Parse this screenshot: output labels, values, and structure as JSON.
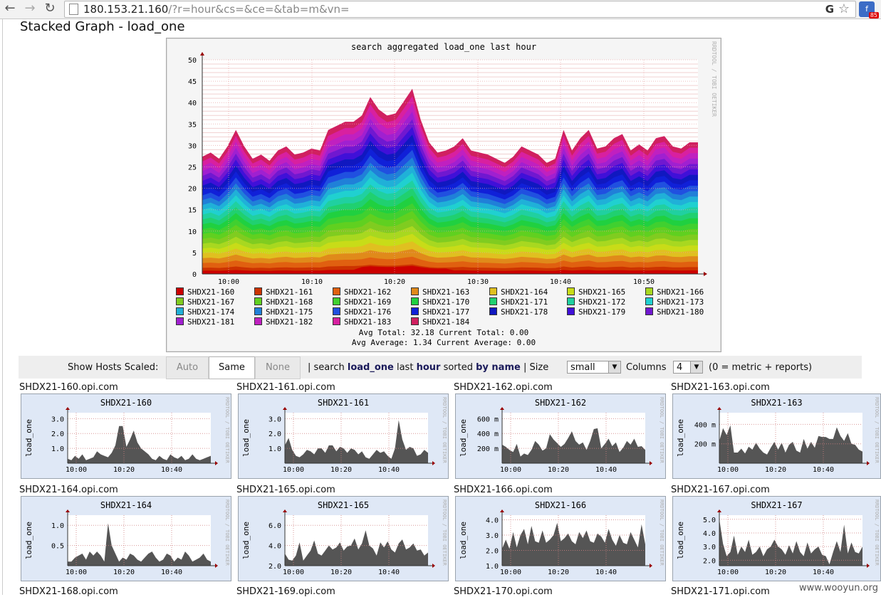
{
  "browser": {
    "url_host": "180.153.21.160",
    "url_rest": "/?r=hour&cs=&ce=&tab=m&vn=",
    "ext_badge": "85",
    "back_icon": "arrow-left-icon",
    "forward_icon": "arrow-right-icon",
    "reload_icon": "reload-icon"
  },
  "page": {
    "title": "Stacked Graph - load_one"
  },
  "main_graph": {
    "title": "search aggregated load_one last hour",
    "side_text": "RRDTOOL / TOBI OETIKER",
    "avg_total_line": "Avg Total: 32.18   Current Total:  0.00",
    "avg_avg_line": "Avg Average:  1.34   Current Average:  0.00"
  },
  "chart_data": [
    {
      "type": "area",
      "title": "search aggregated load_one last hour",
      "xlabel": "",
      "ylabel": "",
      "ylim": [
        0,
        50
      ],
      "y_ticks": [
        0,
        5,
        10,
        15,
        20,
        25,
        30,
        35,
        40,
        45,
        50
      ],
      "x_tick_labels": [
        "10:00",
        "10:10",
        "10:20",
        "10:30",
        "10:40",
        "10:50"
      ],
      "legend_placement": "bottom",
      "total_envelope": [
        28.5,
        29.5,
        28,
        31,
        35,
        31,
        28,
        29,
        27.5,
        30,
        31,
        29,
        29.5,
        30.5,
        30,
        35,
        36,
        37,
        37,
        38.5,
        43,
        40,
        38.5,
        39,
        42,
        45,
        37.5,
        32,
        29.5,
        30,
        31,
        33,
        30,
        29.5,
        29,
        28,
        27,
        28.5,
        31,
        30,
        29,
        27,
        28,
        35,
        30,
        33,
        35,
        30.5,
        31,
        33,
        34,
        30,
        31.5,
        30,
        33,
        33.5,
        31,
        30.5,
        32,
        32
      ],
      "series": [
        {
          "name": "SHDX21-160",
          "color": "#cc0000"
        },
        {
          "name": "SHDX21-161",
          "color": "#cc3300"
        },
        {
          "name": "SHDX21-162",
          "color": "#e06010"
        },
        {
          "name": "SHDX21-163",
          "color": "#e08a1a"
        },
        {
          "name": "SHDX21-164",
          "color": "#e0c020"
        },
        {
          "name": "SHDX21-165",
          "color": "#c8dc18"
        },
        {
          "name": "SHDX21-166",
          "color": "#a8d820"
        },
        {
          "name": "SHDX21-167",
          "color": "#80cc20"
        },
        {
          "name": "SHDX21-168",
          "color": "#60d020"
        },
        {
          "name": "SHDX21-169",
          "color": "#40d030"
        },
        {
          "name": "SHDX21-170",
          "color": "#20d040"
        },
        {
          "name": "SHDX21-171",
          "color": "#20d070"
        },
        {
          "name": "SHDX21-172",
          "color": "#20d0a0"
        },
        {
          "name": "SHDX21-173",
          "color": "#20d0d0"
        },
        {
          "name": "SHDX21-174",
          "color": "#20b0d8"
        },
        {
          "name": "SHDX21-175",
          "color": "#2080d8"
        },
        {
          "name": "SHDX21-176",
          "color": "#2050e0"
        },
        {
          "name": "SHDX21-177",
          "color": "#1020d8"
        },
        {
          "name": "SHDX21-178",
          "color": "#1018c0"
        },
        {
          "name": "SHDX21-179",
          "color": "#4010d8"
        },
        {
          "name": "SHDX21-180",
          "color": "#7018d0"
        },
        {
          "name": "SHDX21-181",
          "color": "#a020d0"
        },
        {
          "name": "SHDX21-182",
          "color": "#c020c0"
        },
        {
          "name": "SHDX21-183",
          "color": "#d820a0"
        },
        {
          "name": "SHDX21-184",
          "color": "#d02060"
        }
      ]
    },
    {
      "type": "area",
      "title": "SHDX21-160",
      "ylabel": "load_one",
      "y_ticks": [
        "1.0",
        "2.0",
        "3.0"
      ],
      "ylim": [
        0,
        3.4
      ],
      "x_tick_labels": [
        "10:00",
        "10:20",
        "10:40"
      ],
      "values": [
        0.3,
        0.2,
        0.5,
        0.3,
        0.6,
        0.2,
        0.3,
        0.4,
        0.8,
        0.6,
        0.5,
        0.4,
        0.7,
        1.2,
        2.5,
        2.5,
        1.1,
        1.6,
        2.2,
        1.4,
        1.0,
        0.8,
        0.6,
        0.3,
        0.2,
        0.5,
        0.3,
        0.2,
        0.6,
        0.4,
        0.3,
        0.5,
        0.2,
        0.3,
        0.6,
        0.3,
        0.2,
        0.3,
        0.4,
        0.5
      ]
    },
    {
      "type": "area",
      "title": "SHDX21-161",
      "ylabel": "load_one",
      "y_ticks": [
        "1.0",
        "2.0",
        "3.0"
      ],
      "ylim": [
        0,
        3.4
      ],
      "x_tick_labels": [
        "10:00",
        "10:20",
        "10:40"
      ],
      "values": [
        1.2,
        1.7,
        0.9,
        0.5,
        0.4,
        0.6,
        0.9,
        0.8,
        0.6,
        1.0,
        1.0,
        0.7,
        1.2,
        1.2,
        0.8,
        1.1,
        1.0,
        0.7,
        1.0,
        0.9,
        0.6,
        0.8,
        0.4,
        0.3,
        0.6,
        0.9,
        0.7,
        0.8,
        0.5,
        0.3,
        1.0,
        2.9,
        1.6,
        0.9,
        1.1,
        1.0,
        0.5,
        0.6,
        0.9,
        0.7
      ]
    },
    {
      "type": "area",
      "title": "SHDX21-162",
      "ylabel": "load_one",
      "y_ticks": [
        "200 m",
        "400 m",
        "600 m"
      ],
      "ylim": [
        0,
        680
      ],
      "x_tick_labels": [
        "10:00",
        "10:20",
        "10:40"
      ],
      "values": [
        250,
        220,
        180,
        150,
        260,
        90,
        130,
        110,
        180,
        300,
        250,
        170,
        200,
        390,
        320,
        270,
        220,
        260,
        340,
        430,
        300,
        250,
        280,
        180,
        300,
        460,
        470,
        200,
        260,
        330,
        230,
        280,
        150,
        210,
        300,
        250,
        330,
        220,
        230,
        180
      ]
    },
    {
      "type": "area",
      "title": "SHDX21-163",
      "ylabel": "load_one",
      "y_ticks": [
        "200 m",
        "400 m"
      ],
      "ylim": [
        0,
        520
      ],
      "x_tick_labels": [
        "10:00",
        "10:20",
        "10:40"
      ],
      "values": [
        230,
        360,
        290,
        390,
        110,
        110,
        150,
        100,
        170,
        140,
        210,
        150,
        110,
        90,
        160,
        220,
        140,
        210,
        110,
        190,
        220,
        130,
        110,
        250,
        150,
        220,
        160,
        280,
        270,
        270,
        250,
        250,
        370,
        280,
        230,
        310,
        200,
        190,
        140,
        120
      ]
    },
    {
      "type": "area",
      "title": "SHDX21-164",
      "ylabel": "load_one",
      "y_ticks": [
        "0.5",
        "1.0"
      ],
      "ylim": [
        0,
        1.25
      ],
      "x_tick_labels": [
        "10:00",
        "10:20",
        "10:40"
      ],
      "values": [
        0.1,
        0.1,
        0.2,
        0.25,
        0.3,
        0.15,
        0.35,
        0.25,
        0.35,
        0.25,
        0.1,
        1.05,
        0.5,
        0.3,
        0.1,
        0.2,
        0.15,
        0.3,
        0.25,
        0.15,
        0.1,
        0.2,
        0.3,
        0.35,
        0.2,
        0.1,
        0.15,
        0.3,
        0.25,
        0.1,
        0.2,
        0.15,
        0.35,
        0.25,
        0.1,
        0.15,
        0.2,
        0.3,
        0.15,
        0.1
      ]
    },
    {
      "type": "area",
      "title": "SHDX21-165",
      "ylabel": "load_one",
      "y_ticks": [
        "2.0",
        "4.0",
        "6.0"
      ],
      "ylim": [
        2,
        7.0
      ],
      "x_tick_labels": [
        "10:00",
        "10:20",
        "10:40"
      ],
      "values": [
        3.2,
        2.6,
        2.5,
        3.0,
        4.3,
        2.5,
        3.0,
        3.5,
        4.5,
        3.2,
        3.0,
        3.5,
        4.0,
        3.6,
        3.8,
        4.3,
        3.5,
        3.9,
        4.0,
        4.7,
        3.6,
        4.2,
        5.5,
        4.0,
        3.7,
        3.0,
        4.3,
        3.8,
        4.4,
        3.6,
        3.3,
        4.2,
        4.6,
        3.6,
        3.8,
        4.2,
        3.5,
        3.6,
        3.0,
        3.3
      ]
    },
    {
      "type": "area",
      "title": "SHDX21-166",
      "ylabel": "load_one",
      "y_ticks": [
        "1.0",
        "2.0",
        "3.0",
        "4.0"
      ],
      "ylim": [
        1,
        4.3
      ],
      "x_tick_labels": [
        "10:00",
        "10:20",
        "10:40"
      ],
      "values": [
        2.1,
        2.7,
        2.1,
        3.2,
        2.2,
        3.0,
        3.4,
        2.4,
        3.6,
        2.6,
        2.5,
        3.3,
        2.5,
        2.7,
        3.0,
        3.8,
        2.6,
        2.8,
        3.1,
        2.6,
        2.4,
        3.2,
        2.8,
        3.3,
        2.6,
        2.5,
        3.1,
        2.9,
        2.5,
        3.4,
        2.7,
        2.3,
        3.0,
        2.5,
        2.4,
        3.2,
        2.7,
        2.2,
        3.7,
        2.4
      ]
    },
    {
      "type": "area",
      "title": "SHDX21-167",
      "ylabel": "load_one",
      "y_ticks": [
        "2.0",
        "3.0",
        "4.0",
        "5.0"
      ],
      "ylim": [
        1.6,
        5.3
      ],
      "x_tick_labels": [
        "10:00",
        "10:20",
        "10:40"
      ],
      "values": [
        5.0,
        3.2,
        2.3,
        2.6,
        3.8,
        2.4,
        3.0,
        2.6,
        3.5,
        2.4,
        2.6,
        3.0,
        2.3,
        2.8,
        3.0,
        3.5,
        3.0,
        2.8,
        2.4,
        3.1,
        2.5,
        3.4,
        2.6,
        2.3,
        3.3,
        2.5,
        2.8,
        3.0,
        2.4,
        2.3,
        1.7,
        2.6,
        3.4,
        2.6,
        4.6,
        2.5,
        3.3,
        2.6,
        2.5,
        3.0
      ]
    }
  ],
  "controls": {
    "show_hosts_label": "Show Hosts Scaled:",
    "btn_auto": "Auto",
    "btn_same": "Same",
    "btn_none": "None",
    "sep1": "|",
    "search_word": "search",
    "metric": "load_one",
    "last_word": "last",
    "range": "hour",
    "sorted_word": "sorted",
    "sort": "by name",
    "sep2": "|",
    "size_label": "Size",
    "size_value": "small",
    "columns_label": "Columns",
    "columns_value": "4",
    "hint": "(0 = metric + reports)"
  },
  "hosts": [
    "SHDX21-160.opi.com",
    "SHDX21-161.opi.com",
    "SHDX21-162.opi.com",
    "SHDX21-163.opi.com",
    "SHDX21-164.opi.com",
    "SHDX21-165.opi.com",
    "SHDX21-166.opi.com",
    "SHDX21-167.opi.com",
    "SHDX21-168.opi.com",
    "SHDX21-169.opi.com",
    "SHDX21-170.opi.com",
    "SHDX21-171.opi.com"
  ],
  "small_graph_side_text": "RRDTOOL / TOBI OETIKER",
  "watermark": "www.wooyun.org"
}
